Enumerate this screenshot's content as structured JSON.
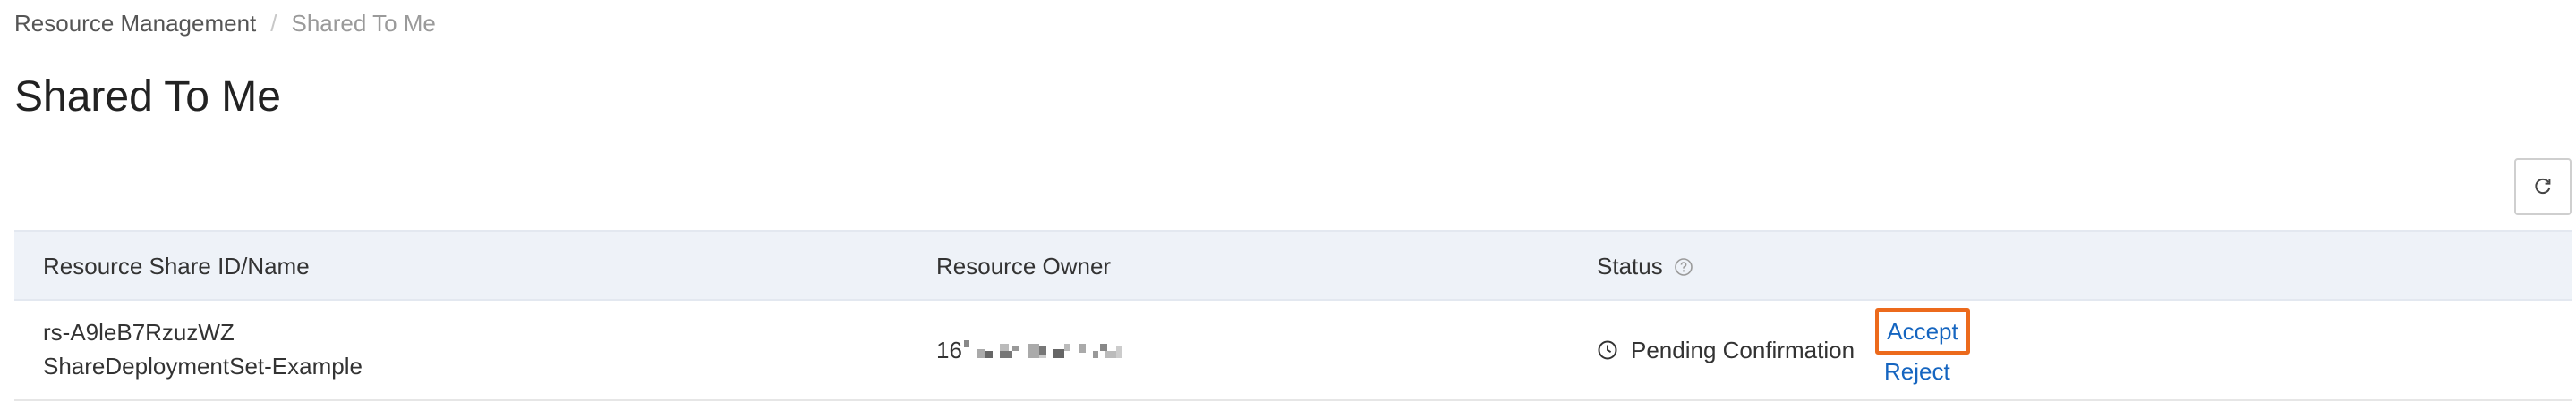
{
  "breadcrumb": {
    "items": [
      "Resource Management",
      "Shared To Me"
    ],
    "separator": "/"
  },
  "page_title": "Shared To Me",
  "toolbar": {
    "refresh_icon": "refresh-icon"
  },
  "table": {
    "columns": [
      {
        "label": "Resource Share ID/Name"
      },
      {
        "label": "Resource Owner"
      },
      {
        "label": "Status",
        "help_icon": "question-circle-icon"
      }
    ],
    "rows": [
      {
        "share_id": "rs-A9leB7RzuzWZ",
        "share_name": "ShareDeploymentSet-Example",
        "owner_visible_prefix": "16",
        "owner_masked": true,
        "status_icon": "clock-icon",
        "status": "Pending Confirmation",
        "actions": {
          "accept": "Accept",
          "reject": "Reject"
        }
      }
    ]
  },
  "colors": {
    "link": "#1565c0",
    "highlight_border": "#ec6a1c",
    "header_bg": "#eef2f8"
  }
}
